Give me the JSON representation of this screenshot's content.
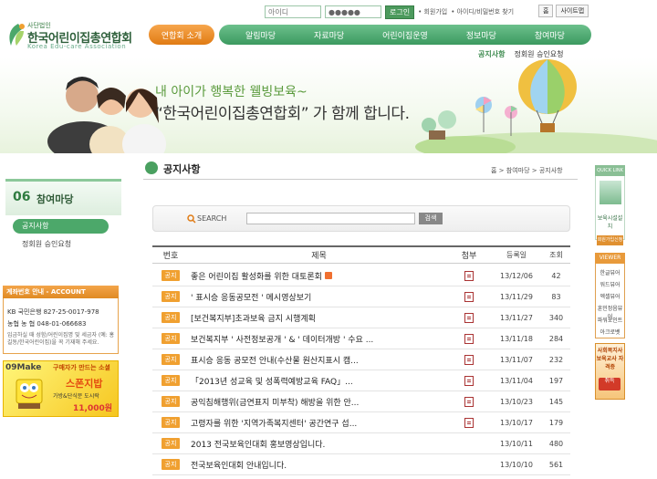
{
  "login": {
    "id_placeholder": "아이디",
    "pw_value": "●●●●●",
    "login_button": "로그인",
    "join_link": "• 회원가입",
    "find_link": "• 아이디/비밀번호 찾기",
    "icons": [
      "홈",
      "사이트맵"
    ]
  },
  "logo": {
    "small": "사단법인",
    "title": "한국어린이집총연합회",
    "english": "Korea Edu-care Association"
  },
  "nav": {
    "intro": "연합회 소개",
    "items": [
      "알림마당",
      "자료마당",
      "어린이집운영",
      "정보마당",
      "참여마당"
    ]
  },
  "subnav": [
    "공지사항",
    "정회원 승인요청"
  ],
  "banner": {
    "line1": "내 아이가 행복한 웰빙보육~",
    "line2": "“한국어린이집총연합회” 가 함께 합니다."
  },
  "left": {
    "number": "06",
    "title": "참여마당",
    "active": "공지사항",
    "sub": "정회원 승인요청",
    "account": {
      "header": "계좌번호 안내 - ACCOUNT NUMBER",
      "line1": "KB 국민은행  827-25-0017-978",
      "line2": "농협 농  협  048-01-066683",
      "note": "입금하실 때 성함/어린이집명 및 세금자 (예: 홍길동/한국어린이집)을 꼭 기재해 주세요."
    },
    "ad": {
      "brand": "09Make",
      "tagline": "구매자가 만드는 소셜",
      "name": "스폰지밥",
      "sub": "가방&단식문 도시락",
      "price": "11,000원"
    }
  },
  "main": {
    "title": "공지사항",
    "breadcrumb": "홈 > 참여마당 > 공지사항",
    "search_label": "SEARCH",
    "search_button": "검색",
    "columns": [
      "번호",
      "제목",
      "첨부",
      "등록일",
      "조회"
    ],
    "badge": "공지",
    "rows": [
      {
        "title": "좋은 어린이집 활성화를 위한 대토론회",
        "new": true,
        "attach": true,
        "date": "13/12/06",
        "views": "42"
      },
      {
        "title": "' 표시승 응동공모전 ' 메시영상보기",
        "new": false,
        "attach": true,
        "date": "13/11/29",
        "views": "83"
      },
      {
        "title": "[보건복지부]초과보육 금지 시행계획",
        "new": false,
        "attach": true,
        "date": "13/11/27",
        "views": "340"
      },
      {
        "title": "보건복지부 ' 사전정보공개 ' & ' 데이터개방 ' 수요 ...",
        "new": false,
        "attach": true,
        "date": "13/11/18",
        "views": "284"
      },
      {
        "title": "표시승 응동 공모전 안내(수산물 원산지표시 캠...",
        "new": false,
        "attach": true,
        "date": "13/11/07",
        "views": "232"
      },
      {
        "title": "「2013년 성교육 및 성폭력예방교육 FAQ」...",
        "new": false,
        "attach": true,
        "date": "13/11/04",
        "views": "197"
      },
      {
        "title": "공익침해행위(금연표지 미부착) 해방을 위한 안...",
        "new": false,
        "attach": true,
        "date": "13/10/23",
        "views": "145"
      },
      {
        "title": "고령자를 위한 '지역가족복지센터' 공간연구 섭...",
        "new": false,
        "attach": true,
        "date": "13/10/17",
        "views": "179"
      },
      {
        "title": "2013 전국보육인대회 홍보영상입니다.",
        "new": false,
        "attach": false,
        "date": "13/10/11",
        "views": "480"
      },
      {
        "title": "전국보육인대회 안내입니다.",
        "new": false,
        "attach": false,
        "date": "13/10/10",
        "views": "561"
      }
    ]
  },
  "right": {
    "quick_header": "QUICK LINK",
    "quick_label": "보육시설설치",
    "quick_more": "회원가입신청서",
    "viewer_header": "VIEWER",
    "viewers": [
      "한글뷰어",
      "워드뷰어",
      "엑셀뷰어",
      "훈민정음뷰어",
      "파워포인트",
      "아크로벳"
    ],
    "welfare_text": "사회복지사 보육교사 자격증",
    "welfare_button": "취득"
  },
  "colors": {
    "green": "#4ca86a",
    "orange": "#f0a030",
    "dark_green": "#2d5f3a"
  }
}
